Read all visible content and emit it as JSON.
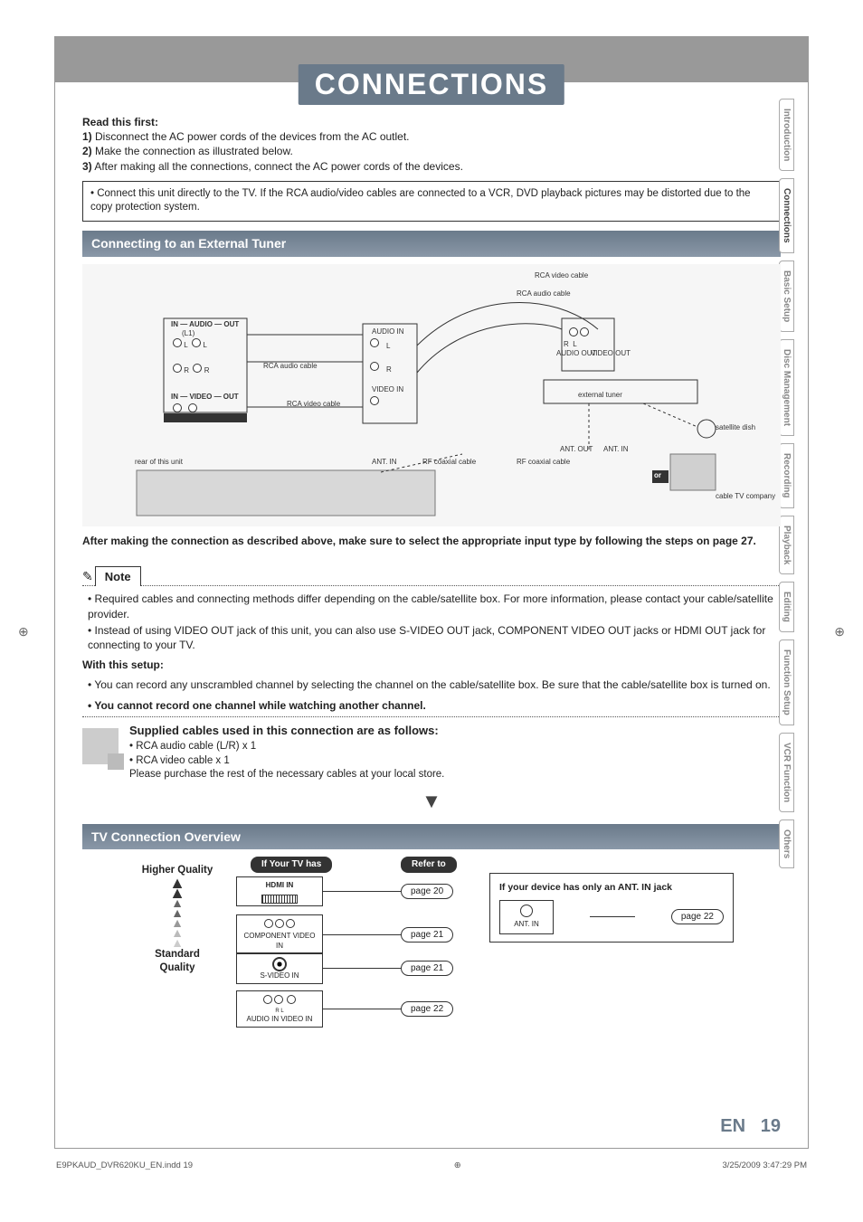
{
  "title": "CONNECTIONS",
  "read_first": {
    "heading": "Read this first:",
    "items": [
      {
        "num": "1)",
        "text": " Disconnect the AC power cords of the devices from the AC outlet."
      },
      {
        "num": "2)",
        "text": " Make the connection as illustrated below."
      },
      {
        "num": "3)",
        "text": " After making all the connections, connect the AC power cords of the devices."
      }
    ]
  },
  "info_bullet": "Connect this unit directly to the TV. If the RCA audio/video cables are connected to a VCR, DVD playback pictures may be distorted due to the copy protection system.",
  "section1": "Connecting to an External Tuner",
  "diagram": {
    "rca_video_top": "RCA video cable",
    "rca_audio_top": "RCA audio cable",
    "unit_in_audio_out": "IN — AUDIO — OUT",
    "unit_l1": "(L1)",
    "unit_l": "L",
    "unit_r": "R",
    "unit_in_video_out": "IN — VIDEO — OUT",
    "rca_audio_cable": "RCA audio cable",
    "rca_video_cable": "RCA video cable",
    "audio_in": "AUDIO IN",
    "video_in": "VIDEO IN",
    "rear_unit": "rear of this unit",
    "ant_in": "ANT. IN",
    "rf_coax": "RF coaxial cable",
    "ext_tuner": "external tuner",
    "audio_out": "AUDIO OUT",
    "video_out": "VIDEO OUT",
    "ant_out": "ANT. OUT",
    "ant_in2": "ANT. IN",
    "sat_dish": "satellite dish",
    "or": "or",
    "cable_co": "cable TV company"
  },
  "after_text": "After making the connection as described above, make sure to select the appropriate input type by following the steps on page 27.",
  "note_label": "Note",
  "notes": [
    "Required cables and connecting methods differ depending on the cable/satellite box. For more information, please contact your cable/satellite provider.",
    "Instead of using VIDEO OUT jack of this unit, you can also use S-VIDEO OUT jack, COMPONENT VIDEO OUT jacks or HDMI OUT jack for connecting to your TV."
  ],
  "with_setup_heading": "With this setup:",
  "with_setup_bullets": [
    "You can record any unscrambled channel by selecting the channel on the cable/satellite box. Be sure that the cable/satellite box is turned on."
  ],
  "with_setup_bold": "You cannot record one channel while watching another channel.",
  "supplied": {
    "heading": "Supplied cables used in this connection are as follows:",
    "lines": [
      "• RCA audio cable (L/R) x 1",
      "• RCA video cable x 1",
      "Please purchase the rest of the necessary cables at your local store."
    ]
  },
  "section2": "TV Connection Overview",
  "tv_over": {
    "higher": "Higher Quality",
    "standard": "Standard Quality",
    "if_tv_has": "If Your TV has",
    "refer_to": "Refer to",
    "rows": [
      {
        "label": "HDMI IN",
        "page": "page 20"
      },
      {
        "label": "COMPONENT VIDEO IN",
        "page": "page 21"
      },
      {
        "label": "S-VIDEO IN",
        "page": "page 21"
      },
      {
        "label": "AUDIO IN   VIDEO IN",
        "sub": "R    L",
        "page": "page 22"
      }
    ],
    "ant_heading": "If your device has only an ANT. IN jack",
    "ant_label": "ANT. IN",
    "ant_page": "page 22"
  },
  "page_num": {
    "lang": "EN",
    "num": "19"
  },
  "side_tabs": [
    "Introduction",
    "Connections",
    "Basic Setup",
    "Disc Management",
    "Recording",
    "Playback",
    "Editing",
    "Function Setup",
    "VCR Function",
    "Others"
  ],
  "footer": {
    "left": "E9PKAUD_DVR620KU_EN.indd   19",
    "right": "3/25/2009   3:47:29 PM"
  }
}
